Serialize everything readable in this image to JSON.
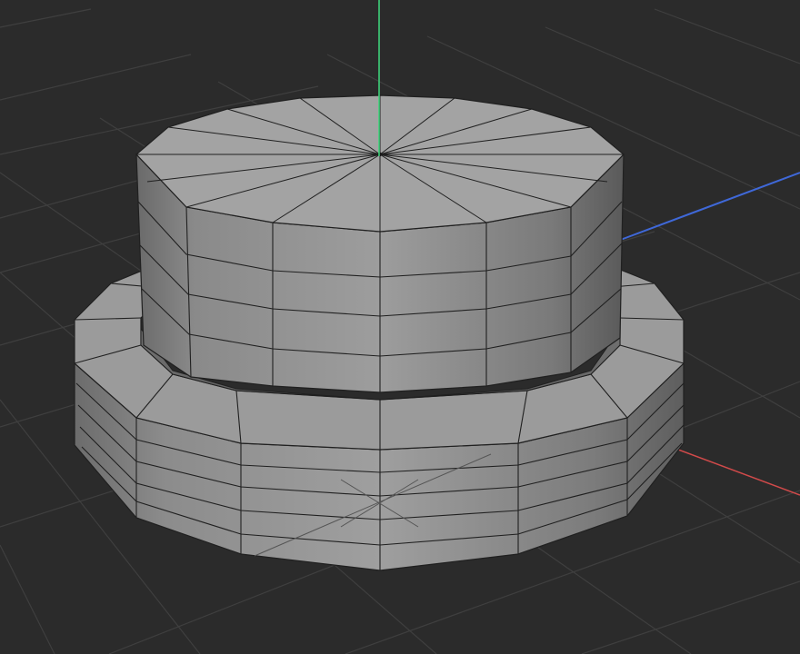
{
  "viewport": {
    "type": "3d-viewport",
    "background": "#2b2b2b",
    "grid_color": "#3f3f3f",
    "axes": {
      "y_color": "#3fd27a",
      "z_color": "#3f68d8",
      "x_color": "#d04a4a"
    },
    "mesh": {
      "objects": [
        "cylinder",
        "ring"
      ],
      "face_color": "#9a9a9a",
      "edge_color": "#202020",
      "segments": 16,
      "show_wireframe": true
    }
  }
}
